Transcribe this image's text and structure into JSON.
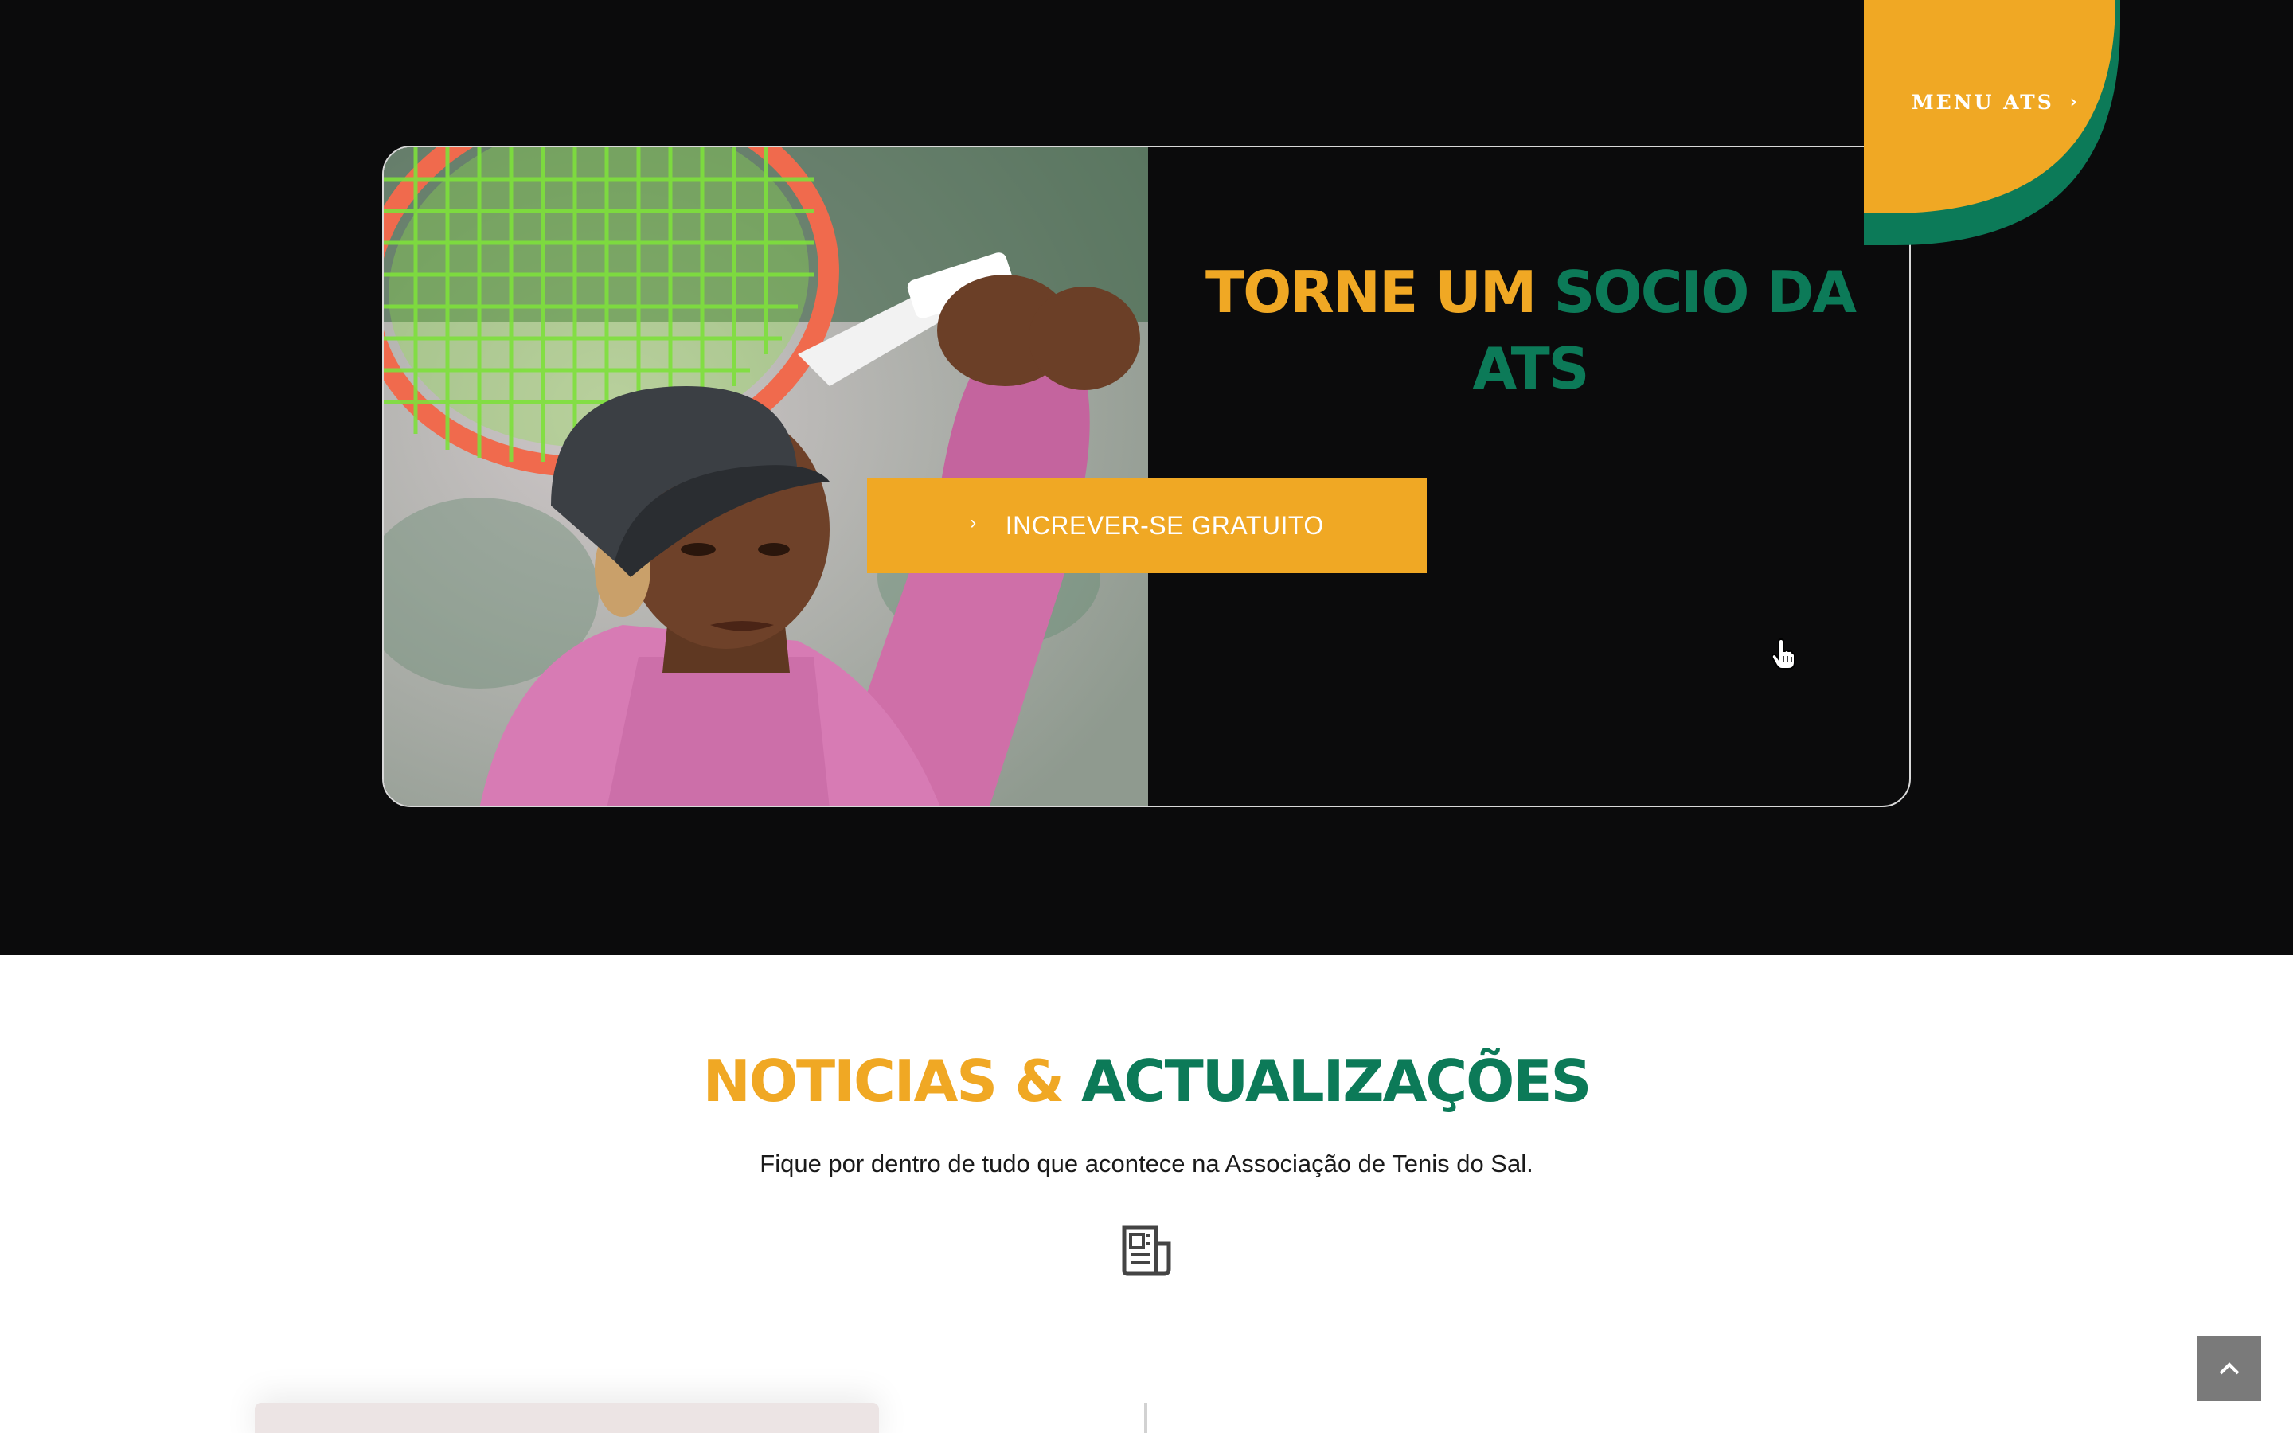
{
  "hero": {
    "title_part1": "TORNE UM ",
    "title_part2": "SOCIO DA ATS",
    "cta_label": "INCREVER-SE GRATUITO",
    "cta_icon": "chevron-right-icon",
    "photo_alt": "tennis-player-photo"
  },
  "menu": {
    "label": "MENU ATS",
    "icon": "chevron-right-icon"
  },
  "news": {
    "title_part1": "NOTICIAS & ",
    "title_part2": "ACTUALIZAÇÕES",
    "subtitle": "Fique por dentro de tudo  que acontece na Associação de Tenis do Sal.",
    "icon": "newspaper-icon"
  },
  "scroll_top": {
    "icon": "chevron-up-icon"
  },
  "colors": {
    "accent_orange": "#f0a824",
    "accent_green": "#0c7a58",
    "dark_bg": "#0b0b0c"
  }
}
